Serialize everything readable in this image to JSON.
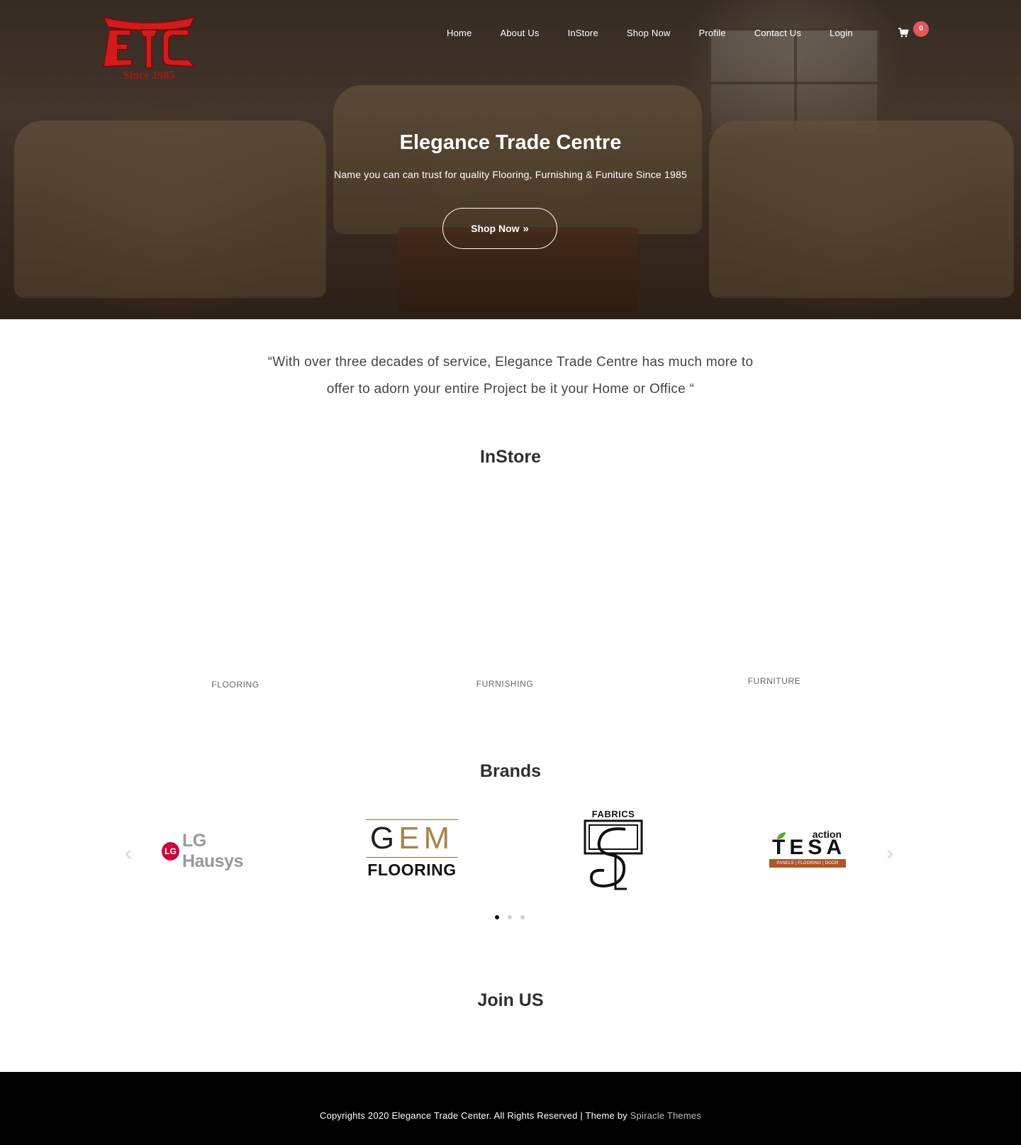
{
  "header": {
    "logo_text": "Since 1985",
    "nav": [
      "Home",
      "About Us",
      "InStore",
      "Shop Now",
      "Profile",
      "Contact Us",
      "Login"
    ],
    "cart_count": "0"
  },
  "hero": {
    "title": "Elegance Trade Centre",
    "subtitle": "Name you can can trust for quality Flooring, Furnishing & Funiture Since 1985",
    "button_label": "Shop Now"
  },
  "quote": {
    "line1": "“With over three decades of service, Elegance Trade Centre has much more to",
    "line2": "offer to adorn your entire Project be it your Home or Office “"
  },
  "instore": {
    "title": "InStore",
    "categories": [
      "FLOORING",
      "FURNISHING",
      "FURNITURE"
    ]
  },
  "brands": {
    "title": "Brands",
    "lg": {
      "mark": "LG",
      "name": "LG Hausys"
    },
    "gem": {
      "g": "G",
      "em": "EM",
      "sub": "FLOORING"
    },
    "fabrics": {
      "label": "FABRICS"
    },
    "tesa": {
      "action": "action",
      "word": "TESA",
      "bar": "PANELS | FLOORING | DOOR SKINS"
    },
    "carousel_pages": 3,
    "active_page": 1
  },
  "join": {
    "title": "Join US"
  },
  "footer": {
    "text": "Copyrights 2020 Elegance Trade Center. All Rights Reserved | Theme by",
    "link": "Spiracle Themes"
  },
  "colors": {
    "logo_red": "#d01c1c",
    "cart_badge": "#e05a5a",
    "footer_bg": "#000000",
    "lg_red": "#c6093b",
    "gem_gold": "#a6844a",
    "tesa_orange": "#b0542a"
  },
  "icons": {
    "cart": "cart-icon",
    "prev": "chevron-left-icon",
    "next": "chevron-right-icon",
    "button_chevron": "double-chevron-right-icon"
  }
}
